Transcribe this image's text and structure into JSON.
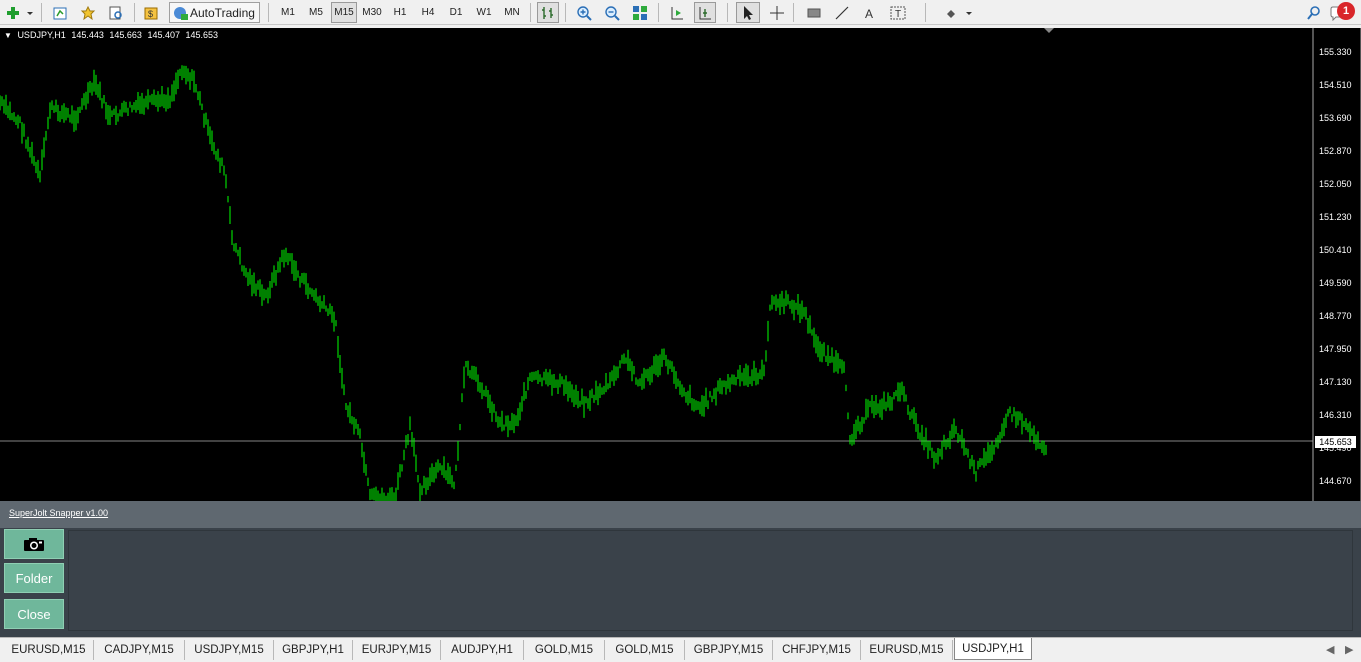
{
  "toolbar": {
    "autotrading_label": "AutoTrading",
    "timeframes": [
      "M1",
      "M5",
      "M15",
      "M30",
      "H1",
      "H4",
      "D1",
      "W1",
      "MN"
    ],
    "active_timeframe": "M15",
    "notification_count": "1",
    "icons": [
      "new-chart-icon",
      "profiles-icon",
      "market-watch-icon",
      "navigator-icon",
      "strategy-tester-icon",
      "new-order-icon",
      "autotrading-icon",
      "bar-chart-icon",
      "zoom-in-icon",
      "zoom-out-icon",
      "tile-windows-icon",
      "auto-scroll-icon",
      "chart-shift-icon",
      "cursor-icon",
      "crosshair-icon",
      "rectangle-icon",
      "line-icon",
      "text-icon",
      "text-label-icon",
      "shapes-icon",
      "search-icon",
      "notification-icon"
    ]
  },
  "chart": {
    "symbol": "USDJPY,H1",
    "open": "145.443",
    "high": "145.663",
    "low": "145.407",
    "close": "145.653",
    "price_levels": [
      "155.330",
      "154.510",
      "153.690",
      "152.870",
      "152.050",
      "151.230",
      "150.410",
      "149.590",
      "148.770",
      "147.950",
      "147.130",
      "146.310",
      "145.490",
      "144.670"
    ],
    "current_price": "145.653",
    "line_color": "#00ff00",
    "background": "#000000"
  },
  "panel": {
    "title": "SuperJolt Snapper v1.00",
    "buttons": {
      "camera_icon": "camera-icon",
      "folder_label": "Folder",
      "close_label": "Close"
    },
    "accent": "#6fb79b"
  },
  "tabs": {
    "items": [
      "EURUSD,M15",
      "CADJPY,M15",
      "USDJPY,M15",
      "GBPJPY,H1",
      "EURJPY,M15",
      "AUDJPY,H1",
      "GOLD,M15",
      "GOLD,M15",
      "GBPJPY,M15",
      "CHFJPY,M15",
      "EURUSD,M15",
      "USDJPY,H1"
    ],
    "active": "USDJPY,H1"
  }
}
